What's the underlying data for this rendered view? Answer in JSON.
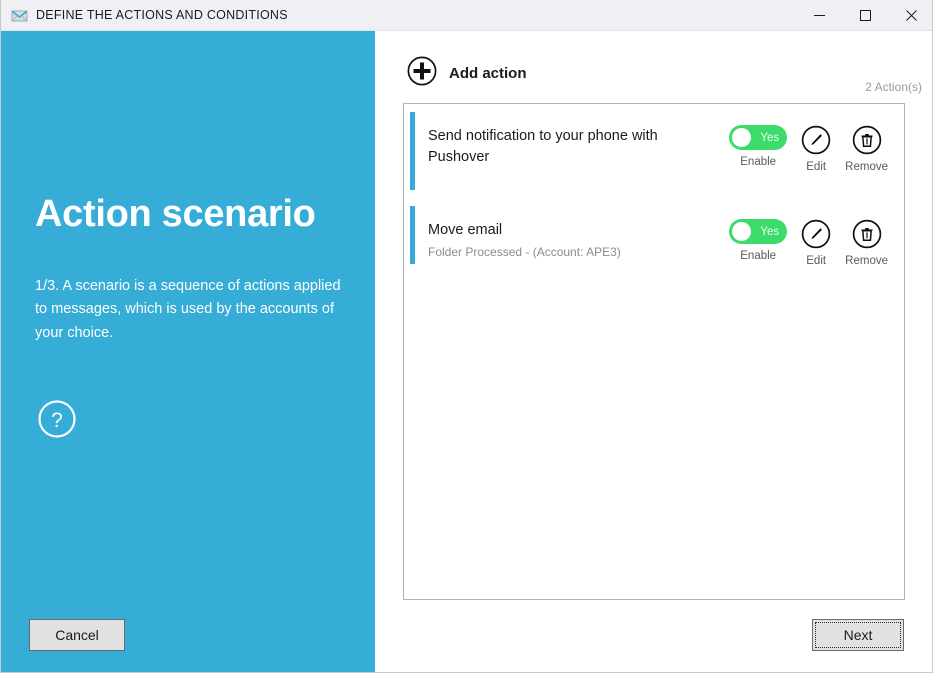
{
  "window": {
    "title": "DEFINE THE ACTIONS AND CONDITIONS",
    "app_icon": "mail-envelope-icon",
    "controls": {
      "minimize": "minimize-icon",
      "maximize": "maximize-icon",
      "close": "close-icon"
    }
  },
  "colors": {
    "panel_blue": "#35add6",
    "accent_blue": "#35aad8",
    "toggle_green": "#3ddc6a",
    "titlebar_bg": "#f0f0f4",
    "button_face": "#e1e1e1"
  },
  "left_panel": {
    "heading": "Action scenario",
    "description": "1/3. A scenario is a sequence of actions applied to messages, which is used by the accounts of your choice.",
    "help_icon": "question-mark-circle-icon",
    "cancel_label": "Cancel"
  },
  "main": {
    "add_action_label": "Add action",
    "add_action_icon": "plus-circle-icon",
    "action_count": "2  Action(s)",
    "actions": [
      {
        "title": "Send notification to your phone with Pushover",
        "subtitle": "",
        "toggle_value": "Yes",
        "toggle_label": "Enable",
        "edit_label": "Edit",
        "edit_icon": "pencil-circle-icon",
        "remove_label": "Remove",
        "remove_icon": "trash-circle-icon"
      },
      {
        "title": "Move email",
        "subtitle": "Folder Processed - (Account: APE3)",
        "toggle_value": "Yes",
        "toggle_label": "Enable",
        "edit_label": "Edit",
        "edit_icon": "pencil-circle-icon",
        "remove_label": "Remove",
        "remove_icon": "trash-circle-icon"
      }
    ],
    "next_label": "Next"
  }
}
